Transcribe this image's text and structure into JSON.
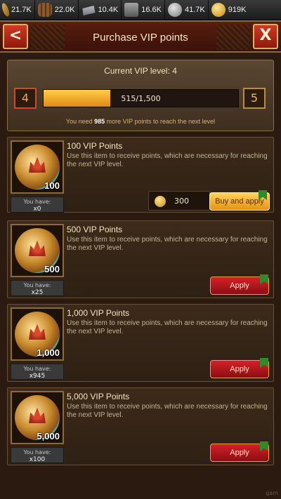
{
  "resources": [
    {
      "icon": "wheat-icon",
      "value": "21.7K"
    },
    {
      "icon": "wood-icon",
      "value": "22.0K"
    },
    {
      "icon": "iron-icon",
      "value": "10.4K"
    },
    {
      "icon": "stone-icon",
      "value": "16.6K"
    },
    {
      "icon": "silver-icon",
      "value": "41.7K"
    },
    {
      "icon": "gold-icon",
      "value": "919K"
    }
  ],
  "header": {
    "title": "Purchase VIP points",
    "back_symbol": "<",
    "close_symbol": "X"
  },
  "vip": {
    "title": "Current VIP level: 4",
    "current_level": "4",
    "next_level": "5",
    "progress_text": "515/1,500",
    "progress_fraction": 0.343,
    "note_prefix": "You need",
    "note_amount": "985",
    "note_suffix": "more VIP points to reach the next level"
  },
  "items": [
    {
      "title": "100 VIP Points",
      "description": "Use this item to receive points, which are necessary for reaching the next VIP level.",
      "amount_label": "100",
      "have_label": "You have:",
      "have_count": "x0",
      "price": "300",
      "button": "Buy and apply"
    },
    {
      "title": "500 VIP Points",
      "description": "Use this item to receive points, which are necessary for reaching the next VIP level.",
      "amount_label": "500",
      "have_label": "You have:",
      "have_count": "x25",
      "button": "Apply"
    },
    {
      "title": "1,000 VIP Points",
      "description": "Use this item to receive points, which are necessary for reaching the next VIP level.",
      "amount_label": "1,000",
      "have_label": "You have:",
      "have_count": "x945",
      "button": "Apply"
    },
    {
      "title": "5,000 VIP Points",
      "description": "Use this item to receive points, which are necessary for reaching the next VIP level.",
      "amount_label": "5,000",
      "have_label": "You have:",
      "have_count": "x100",
      "button": "Apply"
    }
  ],
  "watermark": "gam"
}
